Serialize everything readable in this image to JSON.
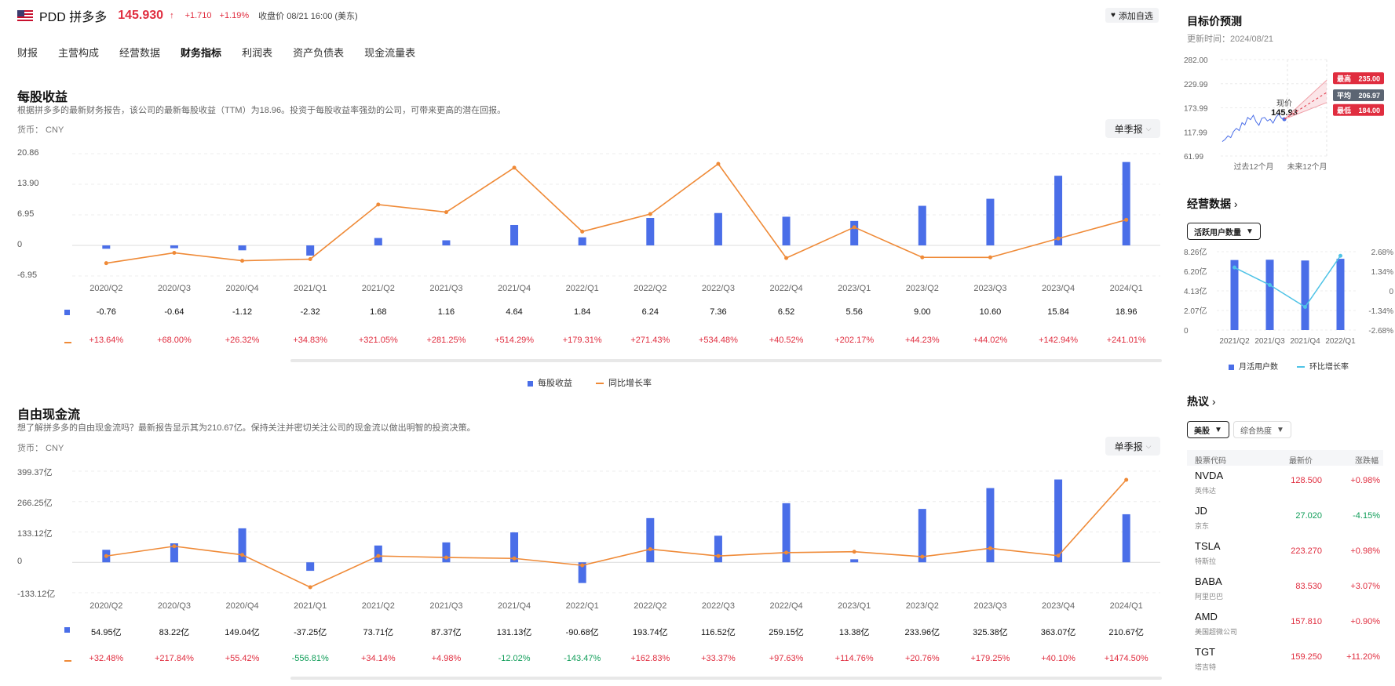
{
  "header": {
    "ticker": "PDD 拼多多",
    "price": "145.930",
    "arrow": "↑",
    "change": "+1.710",
    "change_pct": "+1.19%",
    "close_time": "收盘价 08/21 16:00 (美东)",
    "watch_label": "添加自选"
  },
  "tabs": [
    "财报",
    "主营构成",
    "经营数据",
    "财务指标",
    "利润表",
    "资产负债表",
    "现金流量表"
  ],
  "active_tab": "财务指标",
  "eps": {
    "title": "每股收益",
    "subtitle": "根据拼多多的最新财务报告，该公司的最新每股收益（TTM）为18.96。投资于每股收益率强劲的公司，可带来更高的潜在回报。",
    "currency": "货币：  CNY",
    "period_btn": "单季报",
    "legend_bar": "每股收益",
    "legend_line": "同比增长率"
  },
  "fcf": {
    "title": "自由现金流",
    "subtitle": "想了解拼多多的自由现金流吗？最新报告显示其为210.67亿。保持关注并密切关注公司的现金流以做出明智的投资决策。",
    "currency": "货币：  CNY",
    "period_btn": "单季报"
  },
  "chart_data": [
    {
      "type": "bar",
      "name": "每股收益",
      "categories": [
        "2020/Q2",
        "2020/Q3",
        "2020/Q4",
        "2021/Q1",
        "2021/Q2",
        "2021/Q3",
        "2021/Q4",
        "2022/Q1",
        "2022/Q2",
        "2022/Q3",
        "2022/Q4",
        "2023/Q1",
        "2023/Q2",
        "2023/Q3",
        "2023/Q4",
        "2024/Q1"
      ],
      "y_ticks": [
        "20.86",
        "13.90",
        "6.95",
        "0",
        "-6.95"
      ],
      "ylim": [
        -6.95,
        20.86
      ],
      "series": [
        {
          "name": "每股收益",
          "type": "bar",
          "values": [
            -0.76,
            -0.64,
            -1.12,
            -2.32,
            1.68,
            1.16,
            4.64,
            1.84,
            6.24,
            7.36,
            6.52,
            5.56,
            9.0,
            10.6,
            15.84,
            18.96
          ],
          "labels": [
            "-0.76",
            "-0.64",
            "-1.12",
            "-2.32",
            "1.68",
            "1.16",
            "4.64",
            "1.84",
            "6.24",
            "7.36",
            "6.52",
            "5.56",
            "9.00",
            "10.60",
            "15.84",
            "18.96"
          ]
        },
        {
          "name": "同比增长率",
          "type": "line",
          "values": [
            13.64,
            68.0,
            26.32,
            34.83,
            321.05,
            281.25,
            514.29,
            179.31,
            271.43,
            534.48,
            40.52,
            202.17,
            44.23,
            44.02,
            142.94,
            241.01
          ],
          "labels": [
            "+13.64%",
            "+68.00%",
            "+26.32%",
            "+34.83%",
            "+321.05%",
            "+281.25%",
            "+514.29%",
            "+179.31%",
            "+271.43%",
            "+534.48%",
            "+40.52%",
            "+202.17%",
            "+44.23%",
            "+44.02%",
            "+142.94%",
            "+241.01%"
          ]
        }
      ]
    },
    {
      "type": "bar",
      "name": "自由现金流",
      "categories": [
        "2020/Q2",
        "2020/Q3",
        "2020/Q4",
        "2021/Q1",
        "2021/Q2",
        "2021/Q3",
        "2021/Q4",
        "2022/Q1",
        "2022/Q2",
        "2022/Q3",
        "2022/Q4",
        "2023/Q1",
        "2023/Q2",
        "2023/Q3",
        "2023/Q4",
        "2024/Q1"
      ],
      "y_ticks": [
        "399.37亿",
        "266.25亿",
        "133.12亿",
        "0",
        "-133.12亿"
      ],
      "ylim": [
        -133.12,
        399.37
      ],
      "series": [
        {
          "name": "自由现金流",
          "type": "bar",
          "values": [
            54.95,
            83.22,
            149.04,
            -37.25,
            73.71,
            87.37,
            131.13,
            -90.68,
            193.74,
            116.52,
            259.15,
            13.38,
            233.96,
            325.38,
            363.07,
            210.67
          ],
          "labels": [
            "54.95亿",
            "83.22亿",
            "149.04亿",
            "-37.25亿",
            "73.71亿",
            "87.37亿",
            "131.13亿",
            "-90.68亿",
            "193.74亿",
            "116.52亿",
            "259.15亿",
            "13.38亿",
            "233.96亿",
            "325.38亿",
            "363.07亿",
            "210.67亿"
          ]
        },
        {
          "name": "同比增长率",
          "type": "line",
          "values": [
            32.48,
            217.84,
            55.42,
            -556.81,
            34.14,
            4.98,
            -12.02,
            -143.47,
            162.83,
            33.37,
            97.63,
            114.76,
            20.76,
            179.25,
            40.1,
            1474.5
          ],
          "labels": [
            "+32.48%",
            "+217.84%",
            "+55.42%",
            "-556.81%",
            "+34.14%",
            "+4.98%",
            "-12.02%",
            "-143.47%",
            "+162.83%",
            "+33.37%",
            "+97.63%",
            "+114.76%",
            "+20.76%",
            "+179.25%",
            "+40.10%",
            "+1474.50%"
          ]
        }
      ]
    },
    {
      "type": "line",
      "name": "目标价预测",
      "y_ticks": [
        "282.00",
        "229.99",
        "173.99",
        "117.99",
        "61.99"
      ],
      "ylim": [
        61.99,
        282.0
      ],
      "x_labels": [
        "过去12个月",
        "未来12个月"
      ],
      "current_label": "现价",
      "current": 145.93,
      "targets": [
        {
          "label": "最高",
          "value": 235.0
        },
        {
          "label": "平均",
          "value": 206.97
        },
        {
          "label": "最低",
          "value": 184.0
        }
      ]
    },
    {
      "type": "bar",
      "name": "经营数据",
      "categories": [
        "2021/Q2",
        "2021/Q3",
        "2021/Q4",
        "2022/Q1"
      ],
      "y_ticks_left": [
        "8.26亿",
        "6.20亿",
        "4.13亿",
        "2.07亿",
        "0"
      ],
      "y_ticks_right": [
        "2.68%",
        "1.34%",
        "0",
        "-1.34%",
        "-2.68%"
      ],
      "ylim_left": [
        0,
        8.26
      ],
      "ylim_right": [
        -2.68,
        2.68
      ],
      "series": [
        {
          "name": "月活用户数",
          "type": "bar",
          "values": [
            7.38,
            7.41,
            7.33,
            7.51
          ]
        },
        {
          "name": "环比增长率",
          "type": "line",
          "values": [
            1.6,
            0.4,
            -1.1,
            2.4
          ]
        }
      ]
    }
  ],
  "target": {
    "title": "目标价预测",
    "updated": "更新时间：2024/08/21"
  },
  "ops": {
    "title": "经营数据",
    "chevron": "›",
    "dropdown": "活跃用户数量",
    "legend_bar": "月活用户数",
    "legend_line": "环比增长率"
  },
  "hot": {
    "title": "热议",
    "chevron": "›",
    "filter1": "美股",
    "filter2": "综合热度",
    "col_code": "股票代码",
    "col_price": "最新价",
    "col_change": "涨跌幅",
    "rows": [
      {
        "sym": "NVDA",
        "name": "英伟达",
        "price": "128.500",
        "chg": "+0.98%",
        "dir": "up"
      },
      {
        "sym": "JD",
        "name": "京东",
        "price": "27.020",
        "chg": "-4.15%",
        "dir": "down"
      },
      {
        "sym": "TSLA",
        "name": "特斯拉",
        "price": "223.270",
        "chg": "+0.98%",
        "dir": "up"
      },
      {
        "sym": "BABA",
        "name": "阿里巴巴",
        "price": "83.530",
        "chg": "+3.07%",
        "dir": "up"
      },
      {
        "sym": "AMD",
        "name": "美国超微公司",
        "price": "157.810",
        "chg": "+0.90%",
        "dir": "up"
      },
      {
        "sym": "TGT",
        "name": "塔吉特",
        "price": "159.250",
        "chg": "+11.20%",
        "dir": "up"
      }
    ]
  },
  "colors": {
    "bar": "#4a6ee8",
    "line": "#ef8a37",
    "up": "#e02d3f",
    "down": "#0f9d58",
    "ops_line": "#4fc3e6"
  }
}
